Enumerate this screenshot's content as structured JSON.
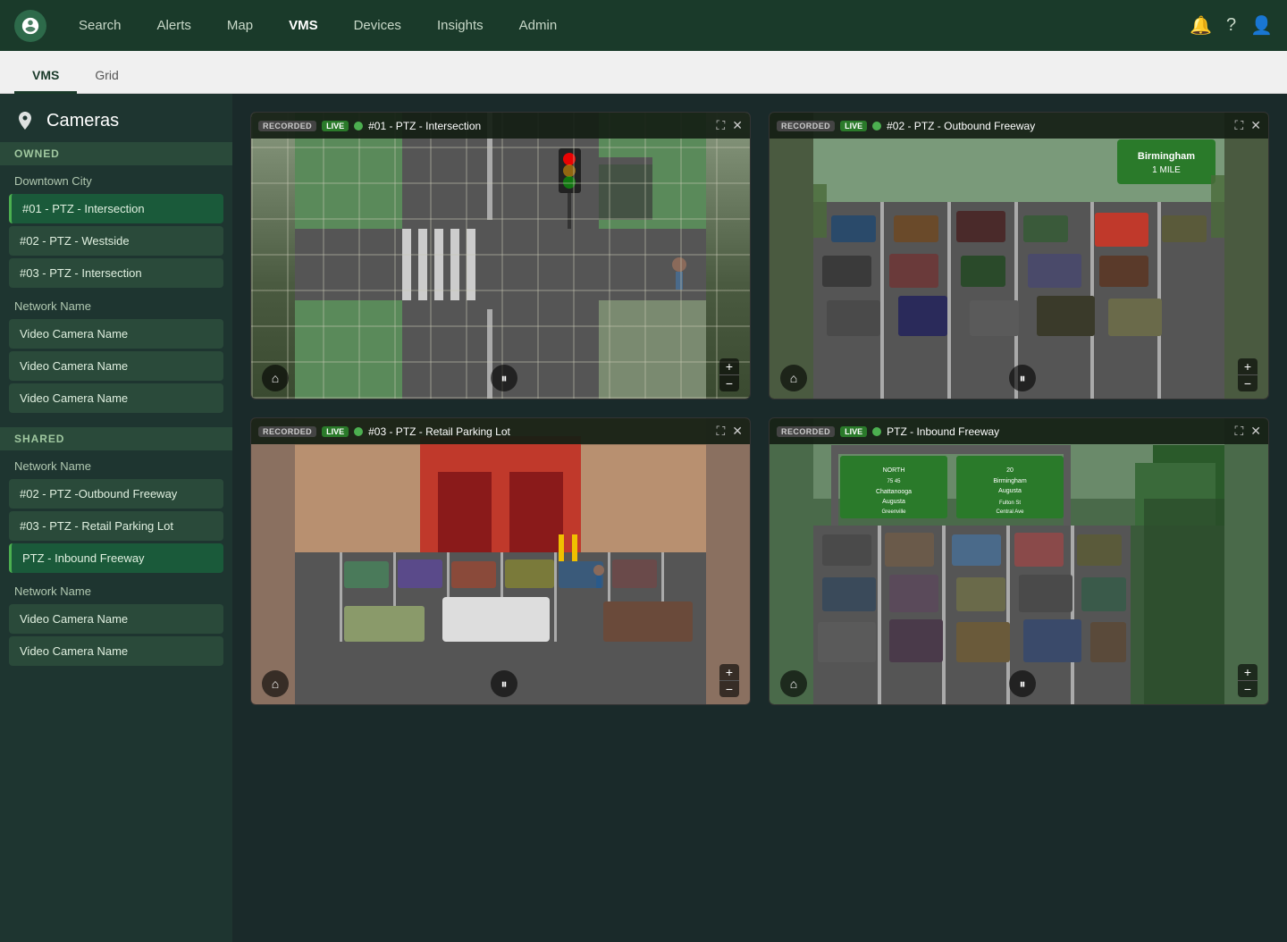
{
  "navbar": {
    "items": [
      {
        "label": "Search",
        "active": false
      },
      {
        "label": "Alerts",
        "active": false
      },
      {
        "label": "Map",
        "active": false
      },
      {
        "label": "VMS",
        "active": true
      },
      {
        "label": "Devices",
        "active": false
      },
      {
        "label": "Insights",
        "active": false
      },
      {
        "label": "Admin",
        "active": false
      }
    ]
  },
  "tabs": [
    {
      "label": "VMS",
      "active": true
    },
    {
      "label": "Grid",
      "active": false
    }
  ],
  "sidebar": {
    "title": "Cameras",
    "sections": [
      {
        "type": "owned",
        "label": "OWNED",
        "groups": [
          {
            "name": "Downtown City",
            "items": [
              {
                "label": "#01 - PTZ -  Intersection",
                "active": true
              },
              {
                "label": "#02 - PTZ - Westside",
                "active": false
              },
              {
                "label": "#03 - PTZ - Intersection",
                "active": false
              }
            ]
          },
          {
            "name": "Network Name",
            "items": [
              {
                "label": "Video Camera Name",
                "active": false
              },
              {
                "label": "Video Camera Name",
                "active": false
              },
              {
                "label": "Video Camera Name",
                "active": false
              }
            ]
          }
        ]
      },
      {
        "type": "shared",
        "label": "SHARED",
        "groups": [
          {
            "name": "Network Name",
            "items": [
              {
                "label": "#02 - PTZ -Outbound Freeway",
                "active": false
              },
              {
                "label": "#03 - PTZ - Retail Parking Lot",
                "active": false
              },
              {
                "label": "PTZ - Inbound Freeway",
                "active": true
              }
            ]
          },
          {
            "name": "Network Name",
            "items": [
              {
                "label": "Video Camera Name",
                "active": false
              },
              {
                "label": "Video Camera Name",
                "active": false
              }
            ]
          }
        ]
      }
    ]
  },
  "cameras": [
    {
      "id": "cam1",
      "badge_recorded": "RECORDED",
      "badge_live": "LIVE",
      "title": "#01 - PTZ - Intersection",
      "bg_class": "cam1-bg"
    },
    {
      "id": "cam2",
      "badge_recorded": "RECORDED",
      "badge_live": "LIVE",
      "title": "#02 - PTZ - Outbound Freeway",
      "bg_class": "cam2-bg"
    },
    {
      "id": "cam3",
      "badge_recorded": "RECORDED",
      "badge_live": "LIVE",
      "title": "#03 - PTZ - Retail Parking Lot",
      "bg_class": "cam3-bg"
    },
    {
      "id": "cam4",
      "badge_recorded": "RECORDED",
      "badge_live": "LIVE",
      "title": "PTZ - Inbound Freeway",
      "bg_class": "cam4-bg"
    }
  ]
}
